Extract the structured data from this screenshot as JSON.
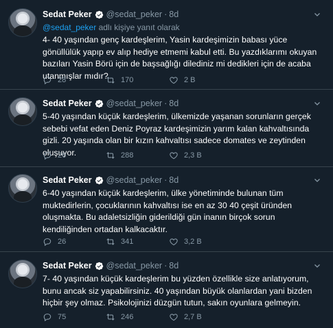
{
  "tweets": [
    {
      "name": "Sedat Peker",
      "handle": "@sedat_peker",
      "time": "8d",
      "reply_to": {
        "mention": "@sedat_peker",
        "text": " adlı kişiye yanıt olarak"
      },
      "text": "4- 40 yaşından genç kardeşlerim, Yasin kardeşimizin babası yüce gönüllülük yapıp ev alıp hediye etmemi kabul etti. Bu yazdıklarımı okuyan bazıları Yasin Börü için de başsağlığı dilediniz mi dedikleri için de acaba utanmışlar mıdır?",
      "replies": "28",
      "retweets": "170",
      "likes": "2 B"
    },
    {
      "name": "Sedat Peker",
      "handle": "@sedat_peker",
      "time": "8d",
      "text": "5-40 yaşından küçük kardeşlerim, ülkemizde yaşanan sorunların gerçek sebebi vefat eden Deniz Poyraz kardeşimizin yarım kalan kahvaltısında gizli. 20 yaşında olan bir kızın kahvaltısı sadece domates ve zeytinden oluşuyor.",
      "replies": "26",
      "retweets": "288",
      "likes": "2,3 B"
    },
    {
      "name": "Sedat Peker",
      "handle": "@sedat_peker",
      "time": "8d",
      "text": "6-40 yaşından küçük kardeşlerim, ülke yönetiminde bulunan tüm muktedirlerin, çocuklarının kahvaltısı ise en az 30 40 çeşit üründen oluşmakta. Bu adaletsizliğin giderildiği gün inanın birçok sorun kendiliğinden ortadan kalkacaktır.",
      "replies": "26",
      "retweets": "341",
      "likes": "3,2 B"
    },
    {
      "name": "Sedat Peker",
      "handle": "@sedat_peker",
      "time": "8d",
      "text": "7- 40 yaşından küçük kardeşlerim bu yüzden özellikle size anlatıyorum, bunu ancak siz yapabilirsiniz. 40 yaşından büyük olanlardan yani bizden hiçbir şey olmaz. Psikolojinizi düzgün tutun, sakın oyunlara gelmeyin.",
      "replies": "75",
      "retweets": "246",
      "likes": "2,7 B"
    }
  ],
  "colors": {
    "background": "#15202b",
    "text": "#ffffff",
    "secondary": "#8899a6",
    "accent": "#1da1f2",
    "divider": "#38444d"
  },
  "icons": [
    "verified-badge-icon",
    "more-chevron-icon",
    "reply-icon",
    "retweet-icon",
    "like-icon"
  ]
}
